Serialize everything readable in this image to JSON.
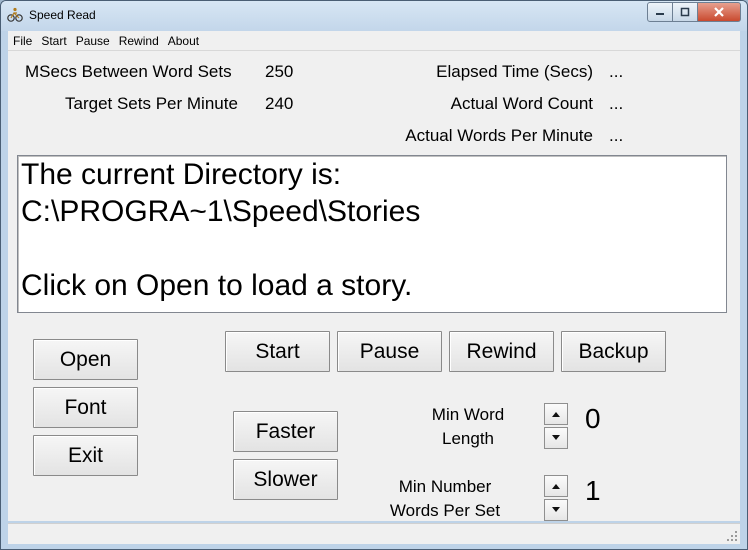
{
  "window": {
    "title": "Speed Read"
  },
  "menu": [
    "File",
    "Start",
    "Pause",
    "Rewind",
    "About"
  ],
  "stats": {
    "msecs_label": "MSecs Between Word Sets",
    "msecs_value": "250",
    "target_label": "Target Sets Per Minute",
    "target_value": "240",
    "elapsed_label": "Elapsed Time (Secs)",
    "elapsed_value": "...",
    "word_count_label": "Actual Word Count",
    "word_count_value": "...",
    "wpm_label": "Actual Words Per Minute",
    "wpm_value": "..."
  },
  "display": {
    "line1": "The current Directory is:",
    "line2": "C:\\PROGRA~1\\Speed\\Stories",
    "line3": "Click on Open to load a story."
  },
  "buttons": {
    "open": "Open",
    "font": "Font",
    "exit": "Exit",
    "start": "Start",
    "pause": "Pause",
    "rewind": "Rewind",
    "backup": "Backup",
    "faster": "Faster",
    "slower": "Slower"
  },
  "settings": {
    "min_word_length_line1": "Min Word",
    "min_word_length_line2": "Length",
    "min_word_length_value": "0",
    "min_words_line1": "Min Number",
    "min_words_line2": "Words Per Set",
    "min_words_value": "1"
  },
  "icons": {
    "app": "bicycle-rider-icon",
    "minimize": "minimize-icon",
    "maximize": "maximize-icon",
    "close": "close-icon",
    "spin_up": "arrow-up-icon",
    "spin_down": "arrow-down-icon",
    "grip": "resize-grip-icon"
  },
  "colors": {
    "titlebar": "#c3d6ea",
    "client": "#f0f0f0",
    "close_button": "#c94a2f"
  }
}
